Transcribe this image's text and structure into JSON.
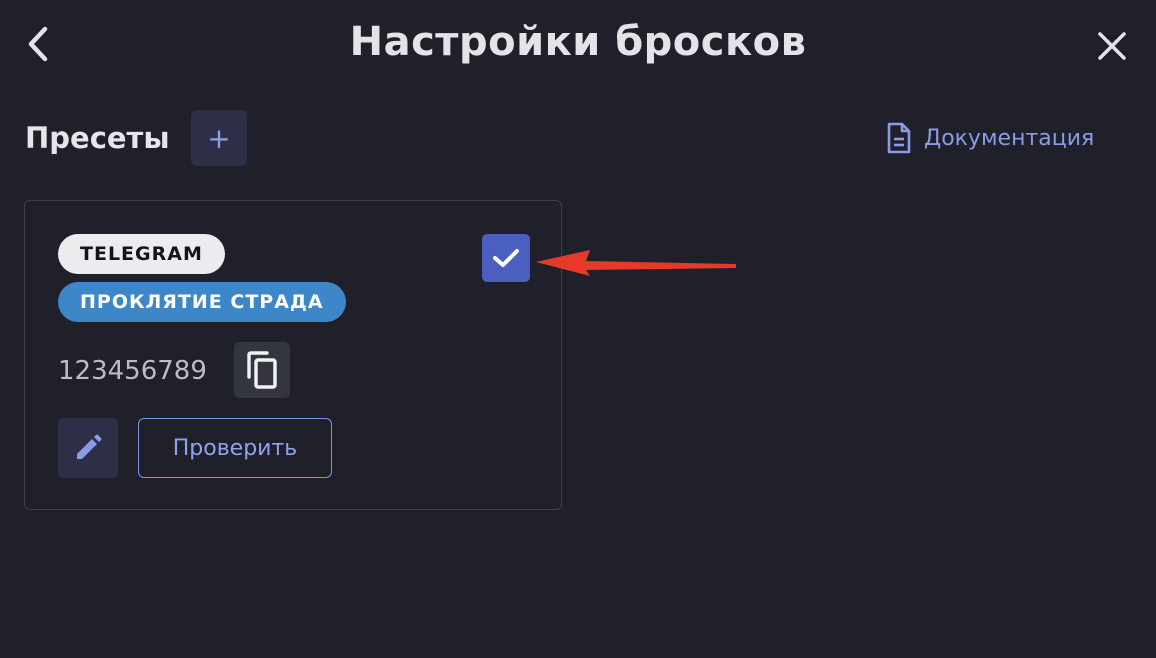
{
  "header": {
    "title": "Настройки бросков",
    "back_icon": "chevron-left-icon",
    "close_icon": "close-icon"
  },
  "presets": {
    "label": "Пресеты",
    "add_label": "+",
    "doc_link": "Документация",
    "doc_icon": "document-icon"
  },
  "card": {
    "platform_tag": "TELEGRAM",
    "game_tag": "ПРОКЛЯТИЕ СТРАДА",
    "id": "123456789",
    "selected": true,
    "check_button": "Проверить",
    "copy_icon": "copy-icon",
    "edit_icon": "pencil-icon"
  },
  "colors": {
    "background": "#1f2029",
    "accent": "#4b5fc0",
    "link": "#8a9be8",
    "game_tag": "#3d86c8",
    "annotation_arrow": "#e5392a"
  }
}
